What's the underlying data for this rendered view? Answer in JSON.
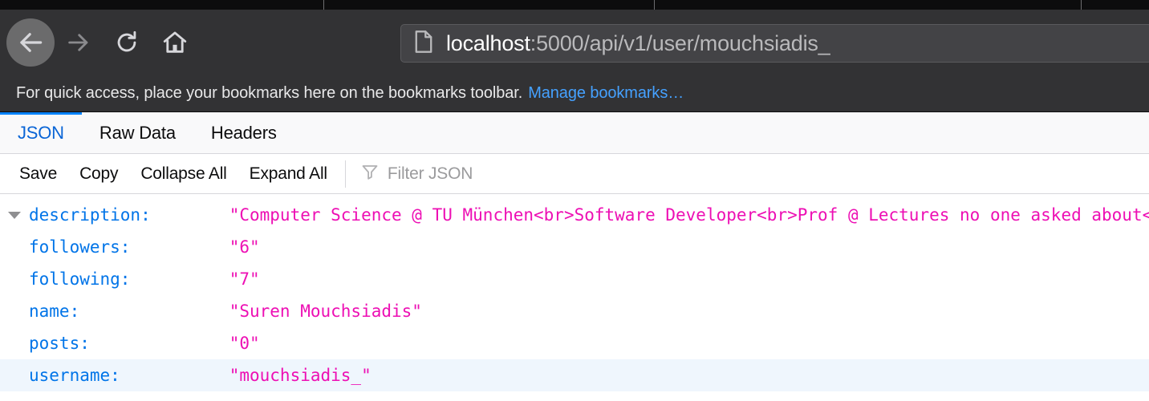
{
  "browser": {
    "nav": {
      "back_label": "Back",
      "forward_label": "Forward",
      "reload_label": "Reload",
      "home_label": "Home"
    },
    "url_bar": {
      "icon": "document-icon",
      "host": "localhost",
      "path": ":5000/api/v1/user/mouchsiadis_",
      "full_url": "localhost:5000/api/v1/user/mouchsiadis_"
    },
    "bookmarks_bar": {
      "message": "For quick access, place your bookmarks here on the bookmarks toolbar.",
      "manage_link": "Manage bookmarks…"
    }
  },
  "viewer": {
    "tabs": [
      {
        "label": "JSON",
        "active": true
      },
      {
        "label": "Raw Data",
        "active": false
      },
      {
        "label": "Headers",
        "active": false
      }
    ],
    "toolbar": {
      "save_label": "Save",
      "copy_label": "Copy",
      "collapse_all_label": "Collapse All",
      "expand_all_label": "Expand All",
      "filter_icon": "filter-funnel-icon",
      "filter_placeholder": "Filter JSON",
      "filter_value": ""
    },
    "rows": [
      {
        "key": "description:",
        "value": "\"Computer Science @ TU München<br>Software Developer<br>Prof @ Lectures no one asked about<",
        "expandable": true,
        "expanded": true,
        "highlight": false
      },
      {
        "key": "followers:",
        "value": "\"6\"",
        "expandable": false,
        "expanded": false,
        "highlight": false
      },
      {
        "key": "following:",
        "value": "\"7\"",
        "expandable": false,
        "expanded": false,
        "highlight": false
      },
      {
        "key": "name:",
        "value": "\"Suren Mouchsiadis\"",
        "expandable": false,
        "expanded": false,
        "highlight": false
      },
      {
        "key": "posts:",
        "value": "\"0\"",
        "expandable": false,
        "expanded": false,
        "highlight": false
      },
      {
        "key": "username:",
        "value": "\"mouchsiadis_\"",
        "expandable": false,
        "expanded": false,
        "highlight": true
      }
    ]
  },
  "colors": {
    "chrome_bg": "#323234",
    "tab_strip_bg": "#0c0c0d",
    "accent_blue": "#0a84ff",
    "link_blue": "#45a1ff",
    "json_key_blue": "#0074e8",
    "json_string_magenta": "#ed0fb4",
    "row_highlight": "#eff6fd"
  }
}
